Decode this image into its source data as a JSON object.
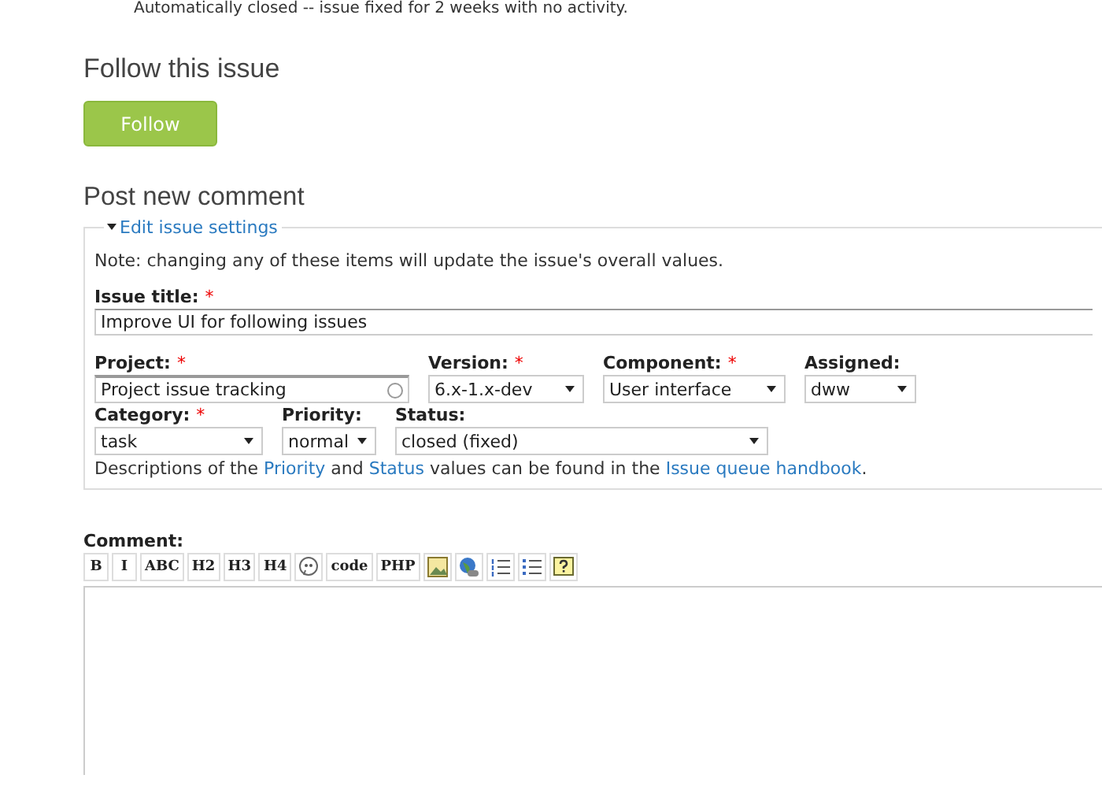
{
  "previous_comment": "Automatically closed -- issue fixed for 2 weeks with no activity.",
  "follow": {
    "heading": "Follow this issue",
    "button": "Follow"
  },
  "comment_form": {
    "heading": "Post new comment",
    "settings": {
      "legend": "Edit issue settings",
      "expanded": true,
      "note": "Note: changing any of these items will update the issue's overall values.",
      "title_field": {
        "label": "Issue title:",
        "required_mark": "*",
        "value": "Improve UI for following issues"
      },
      "fields": [
        {
          "kind": "autocomplete",
          "label": "Project:",
          "required_mark": "*",
          "value": "Project issue tracking"
        },
        {
          "kind": "select",
          "label": "Version:",
          "required_mark": "*",
          "value": "6.x-1.x-dev"
        },
        {
          "kind": "select",
          "label": "Component:",
          "required_mark": "*",
          "value": "User interface"
        },
        {
          "kind": "select",
          "label": "Assigned:",
          "value": "dww"
        },
        {
          "kind": "select",
          "label": "Category:",
          "required_mark": "*",
          "value": "task"
        },
        {
          "kind": "select",
          "label": "Priority:",
          "value": "normal"
        },
        {
          "kind": "select",
          "label": "Status:",
          "value": "closed (fixed)"
        }
      ],
      "help": [
        {
          "kind": "text",
          "text": "Descriptions of the "
        },
        {
          "kind": "link",
          "text": "Priority"
        },
        {
          "kind": "text",
          "text": " and "
        },
        {
          "kind": "link",
          "text": "Status"
        },
        {
          "kind": "text",
          "text": " values can be found in the "
        },
        {
          "kind": "link",
          "text": "Issue queue handbook"
        },
        {
          "kind": "text",
          "text": "."
        }
      ]
    },
    "comment_label": "Comment:",
    "toolbar": [
      {
        "kind": "text",
        "label": "B"
      },
      {
        "kind": "text",
        "label": "I"
      },
      {
        "kind": "text",
        "label": "ABC"
      },
      {
        "kind": "text",
        "label": "H2"
      },
      {
        "kind": "text",
        "label": "H3"
      },
      {
        "kind": "text",
        "label": "H4"
      },
      {
        "kind": "quote"
      },
      {
        "kind": "text",
        "label": "code"
      },
      {
        "kind": "text",
        "label": "PHP"
      },
      {
        "kind": "image"
      },
      {
        "kind": "globe"
      },
      {
        "kind": "numbered"
      },
      {
        "kind": "bulleted"
      },
      {
        "kind": "help"
      }
    ]
  }
}
